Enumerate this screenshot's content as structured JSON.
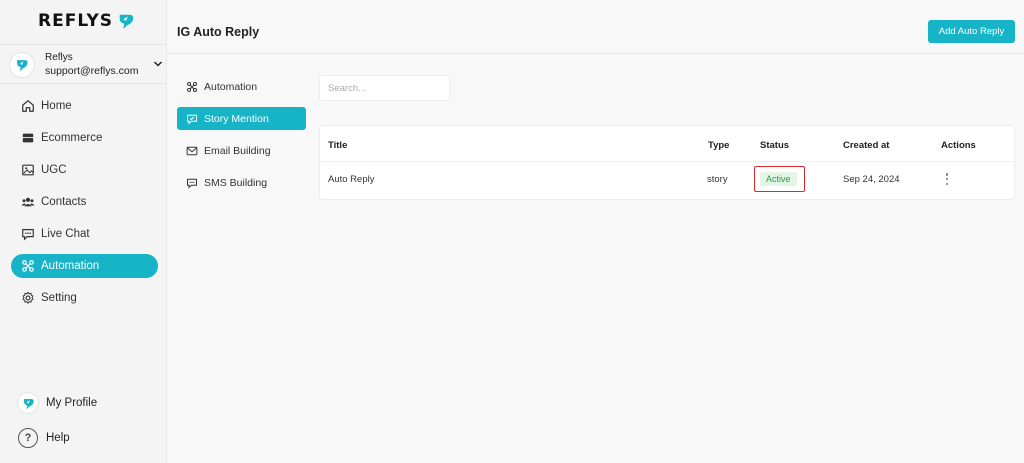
{
  "brand": {
    "name": "REFLYS",
    "accent": "#17b3c7"
  },
  "account": {
    "name": "Reflys",
    "email": "support@reflys.com"
  },
  "sidebar": {
    "items": [
      {
        "label": "Home",
        "icon": "home-icon"
      },
      {
        "label": "Ecommerce",
        "icon": "store-icon"
      },
      {
        "label": "UGC",
        "icon": "image-icon"
      },
      {
        "label": "Contacts",
        "icon": "users-icon"
      },
      {
        "label": "Live Chat",
        "icon": "chat-icon"
      },
      {
        "label": "Automation",
        "icon": "automation-icon",
        "active": true
      },
      {
        "label": "Setting",
        "icon": "gear-icon"
      }
    ],
    "bottom": [
      {
        "label": "My Profile",
        "icon": "profile-logo-icon"
      },
      {
        "label": "Help",
        "icon": "help-icon"
      }
    ]
  },
  "header": {
    "title": "IG Auto Reply",
    "add_button": "Add Auto Reply"
  },
  "subnav": {
    "items": [
      {
        "label": "Automation",
        "icon": "automation-icon"
      },
      {
        "label": "Story Mention",
        "icon": "story-icon",
        "active": true
      },
      {
        "label": "Email Building",
        "icon": "mail-icon"
      },
      {
        "label": "SMS Building",
        "icon": "sms-icon"
      }
    ]
  },
  "search": {
    "placeholder": "Search...",
    "value": ""
  },
  "table": {
    "columns": [
      "Title",
      "Type",
      "Status",
      "Created at",
      "Actions"
    ],
    "rows": [
      {
        "title": "Auto Reply",
        "type": "story",
        "status": "Active",
        "created_at": "Sep 24, 2024"
      }
    ]
  }
}
